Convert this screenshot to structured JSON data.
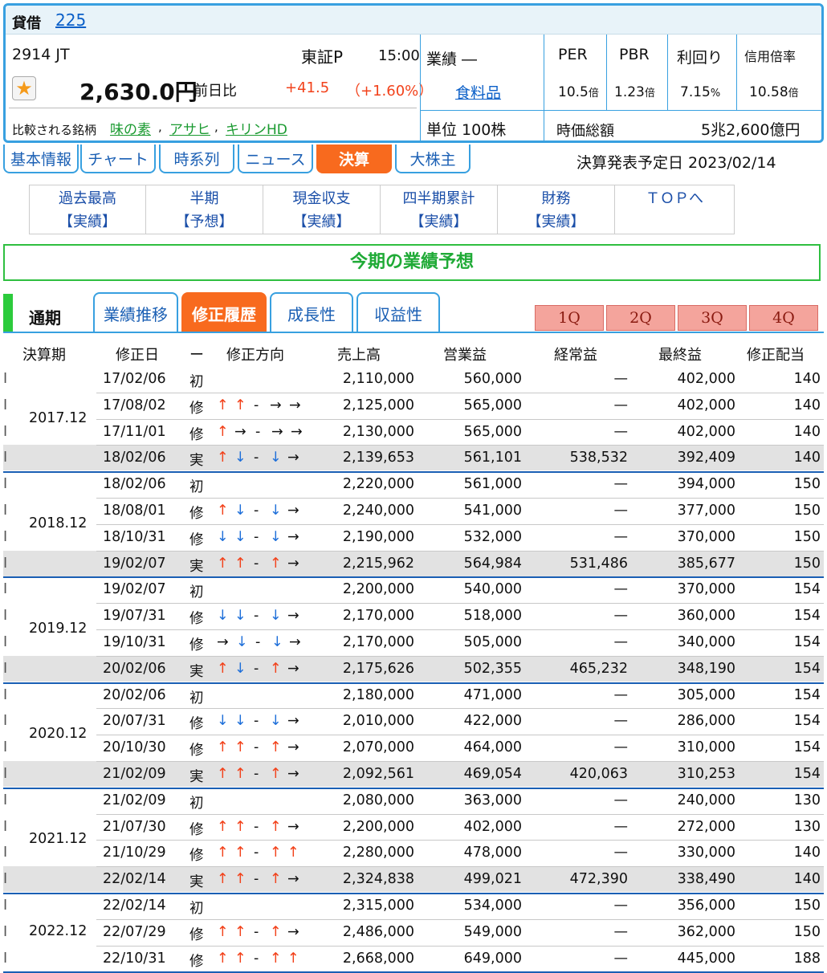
{
  "header": {
    "label": "貸借",
    "index_link": "225"
  },
  "stock": {
    "code_name": "2914 JT",
    "market": "東証P",
    "time": "15:00",
    "price": "2,630.0円",
    "prev_label": "前日比",
    "change": "+41.5",
    "change_pct": "（+1.60%）",
    "compare_label": "比較される銘柄",
    "compare": [
      "味の素",
      "アサヒ",
      "キリンHD"
    ],
    "gyoseki": "業績 ―",
    "industry": "食料品",
    "unit": "単位 100株"
  },
  "metrics": {
    "labels": [
      "PER",
      "PBR",
      "利回り",
      "信用倍率"
    ],
    "values": [
      "10.5",
      "1.23",
      "7.15",
      "10.58"
    ],
    "units": [
      "倍",
      "倍",
      "%",
      "倍"
    ],
    "cap_label": "時価総額",
    "cap_value": "5兆2,600億円"
  },
  "tabs": [
    "基本情報",
    "チャート",
    "時系列",
    "ニュース",
    "決算",
    "大株主"
  ],
  "announce": "決算発表予定日 2023/02/14",
  "subtabs": [
    {
      "t": "過去最高",
      "s": "【実績】"
    },
    {
      "t": "半期",
      "s": "【予想】"
    },
    {
      "t": "現金収支",
      "s": "【実績】"
    },
    {
      "t": "四半期累計",
      "s": "【実績】"
    },
    {
      "t": "財務",
      "s": "【実績】"
    },
    {
      "t": "ＴＯＰへ",
      "s": ""
    }
  ],
  "banner": "今期の業績予想",
  "period_label": "通期",
  "view_tabs": [
    "業績推移",
    "修正履歴",
    "成長性",
    "収益性"
  ],
  "quarters": [
    "1Q",
    "2Q",
    "3Q",
    "4Q"
  ],
  "columns": [
    "決算期",
    "修正日",
    "ー",
    "修正方向",
    "売上高",
    "営業益",
    "経常益",
    "最終益",
    "修正配当"
  ],
  "groups": [
    {
      "period": "2017.12",
      "rows": [
        {
          "d": "17/02/06",
          "k": "初",
          "a": "",
          "s": "2,110,000",
          "o": "560,000",
          "r": "—",
          "n": "402,000",
          "v": "140"
        },
        {
          "d": "17/08/02",
          "k": "修",
          "a": "uu-rr",
          "s": "2,125,000",
          "o": "565,000",
          "r": "—",
          "n": "402,000",
          "v": "140"
        },
        {
          "d": "17/11/01",
          "k": "修",
          "a": "ur-rr",
          "s": "2,130,000",
          "o": "565,000",
          "r": "—",
          "n": "402,000",
          "v": "140"
        },
        {
          "d": "18/02/06",
          "k": "実",
          "a": "ud-dr",
          "s": "2,139,653",
          "o": "561,101",
          "r": "538,532",
          "n": "392,409",
          "v": "140"
        }
      ]
    },
    {
      "period": "2018.12",
      "rows": [
        {
          "d": "18/02/06",
          "k": "初",
          "a": "",
          "s": "2,220,000",
          "o": "561,000",
          "r": "—",
          "n": "394,000",
          "v": "150"
        },
        {
          "d": "18/08/01",
          "k": "修",
          "a": "ud-dr",
          "s": "2,240,000",
          "o": "541,000",
          "r": "—",
          "n": "377,000",
          "v": "150"
        },
        {
          "d": "18/10/31",
          "k": "修",
          "a": "dd-dr",
          "s": "2,190,000",
          "o": "532,000",
          "r": "—",
          "n": "370,000",
          "v": "150"
        },
        {
          "d": "19/02/07",
          "k": "実",
          "a": "uu-ur",
          "s": "2,215,962",
          "o": "564,984",
          "r": "531,486",
          "n": "385,677",
          "v": "150"
        }
      ]
    },
    {
      "period": "2019.12",
      "rows": [
        {
          "d": "19/02/07",
          "k": "初",
          "a": "",
          "s": "2,200,000",
          "o": "540,000",
          "r": "—",
          "n": "370,000",
          "v": "154"
        },
        {
          "d": "19/07/31",
          "k": "修",
          "a": "dd-dr",
          "s": "2,170,000",
          "o": "518,000",
          "r": "—",
          "n": "360,000",
          "v": "154"
        },
        {
          "d": "19/10/31",
          "k": "修",
          "a": "rd-dr",
          "s": "2,170,000",
          "o": "505,000",
          "r": "—",
          "n": "340,000",
          "v": "154"
        },
        {
          "d": "20/02/06",
          "k": "実",
          "a": "ud-ur",
          "s": "2,175,626",
          "o": "502,355",
          "r": "465,232",
          "n": "348,190",
          "v": "154"
        }
      ]
    },
    {
      "period": "2020.12",
      "rows": [
        {
          "d": "20/02/06",
          "k": "初",
          "a": "",
          "s": "2,180,000",
          "o": "471,000",
          "r": "—",
          "n": "305,000",
          "v": "154"
        },
        {
          "d": "20/07/31",
          "k": "修",
          "a": "dd-dr",
          "s": "2,010,000",
          "o": "422,000",
          "r": "—",
          "n": "286,000",
          "v": "154"
        },
        {
          "d": "20/10/30",
          "k": "修",
          "a": "uu-ur",
          "s": "2,070,000",
          "o": "464,000",
          "r": "—",
          "n": "310,000",
          "v": "154"
        },
        {
          "d": "21/02/09",
          "k": "実",
          "a": "uu-ur",
          "s": "2,092,561",
          "o": "469,054",
          "r": "420,063",
          "n": "310,253",
          "v": "154"
        }
      ]
    },
    {
      "period": "2021.12",
      "rows": [
        {
          "d": "21/02/09",
          "k": "初",
          "a": "",
          "s": "2,080,000",
          "o": "363,000",
          "r": "—",
          "n": "240,000",
          "v": "130"
        },
        {
          "d": "21/07/30",
          "k": "修",
          "a": "uu-ur",
          "s": "2,200,000",
          "o": "402,000",
          "r": "—",
          "n": "272,000",
          "v": "130"
        },
        {
          "d": "21/10/29",
          "k": "修",
          "a": "uu-uu",
          "s": "2,280,000",
          "o": "478,000",
          "r": "—",
          "n": "330,000",
          "v": "140"
        },
        {
          "d": "22/02/14",
          "k": "実",
          "a": "uu-ur",
          "s": "2,324,838",
          "o": "499,021",
          "r": "472,390",
          "n": "338,490",
          "v": "140"
        }
      ]
    },
    {
      "period": "2022.12",
      "rows": [
        {
          "d": "22/02/14",
          "k": "初",
          "a": "",
          "s": "2,315,000",
          "o": "534,000",
          "r": "—",
          "n": "356,000",
          "v": "150"
        },
        {
          "d": "22/07/29",
          "k": "修",
          "a": "uu-ur",
          "s": "2,486,000",
          "o": "549,000",
          "r": "—",
          "n": "362,000",
          "v": "150"
        },
        {
          "d": "22/10/31",
          "k": "修",
          "a": "uu-uu",
          "s": "2,668,000",
          "o": "649,000",
          "r": "—",
          "n": "445,000",
          "v": "188"
        }
      ]
    }
  ],
  "colors": {
    "accent": "#38a0e0",
    "active": "#f86a1e",
    "up": "#f2421b",
    "down": "#1e6fd9",
    "banner_text": "#1faa36"
  }
}
